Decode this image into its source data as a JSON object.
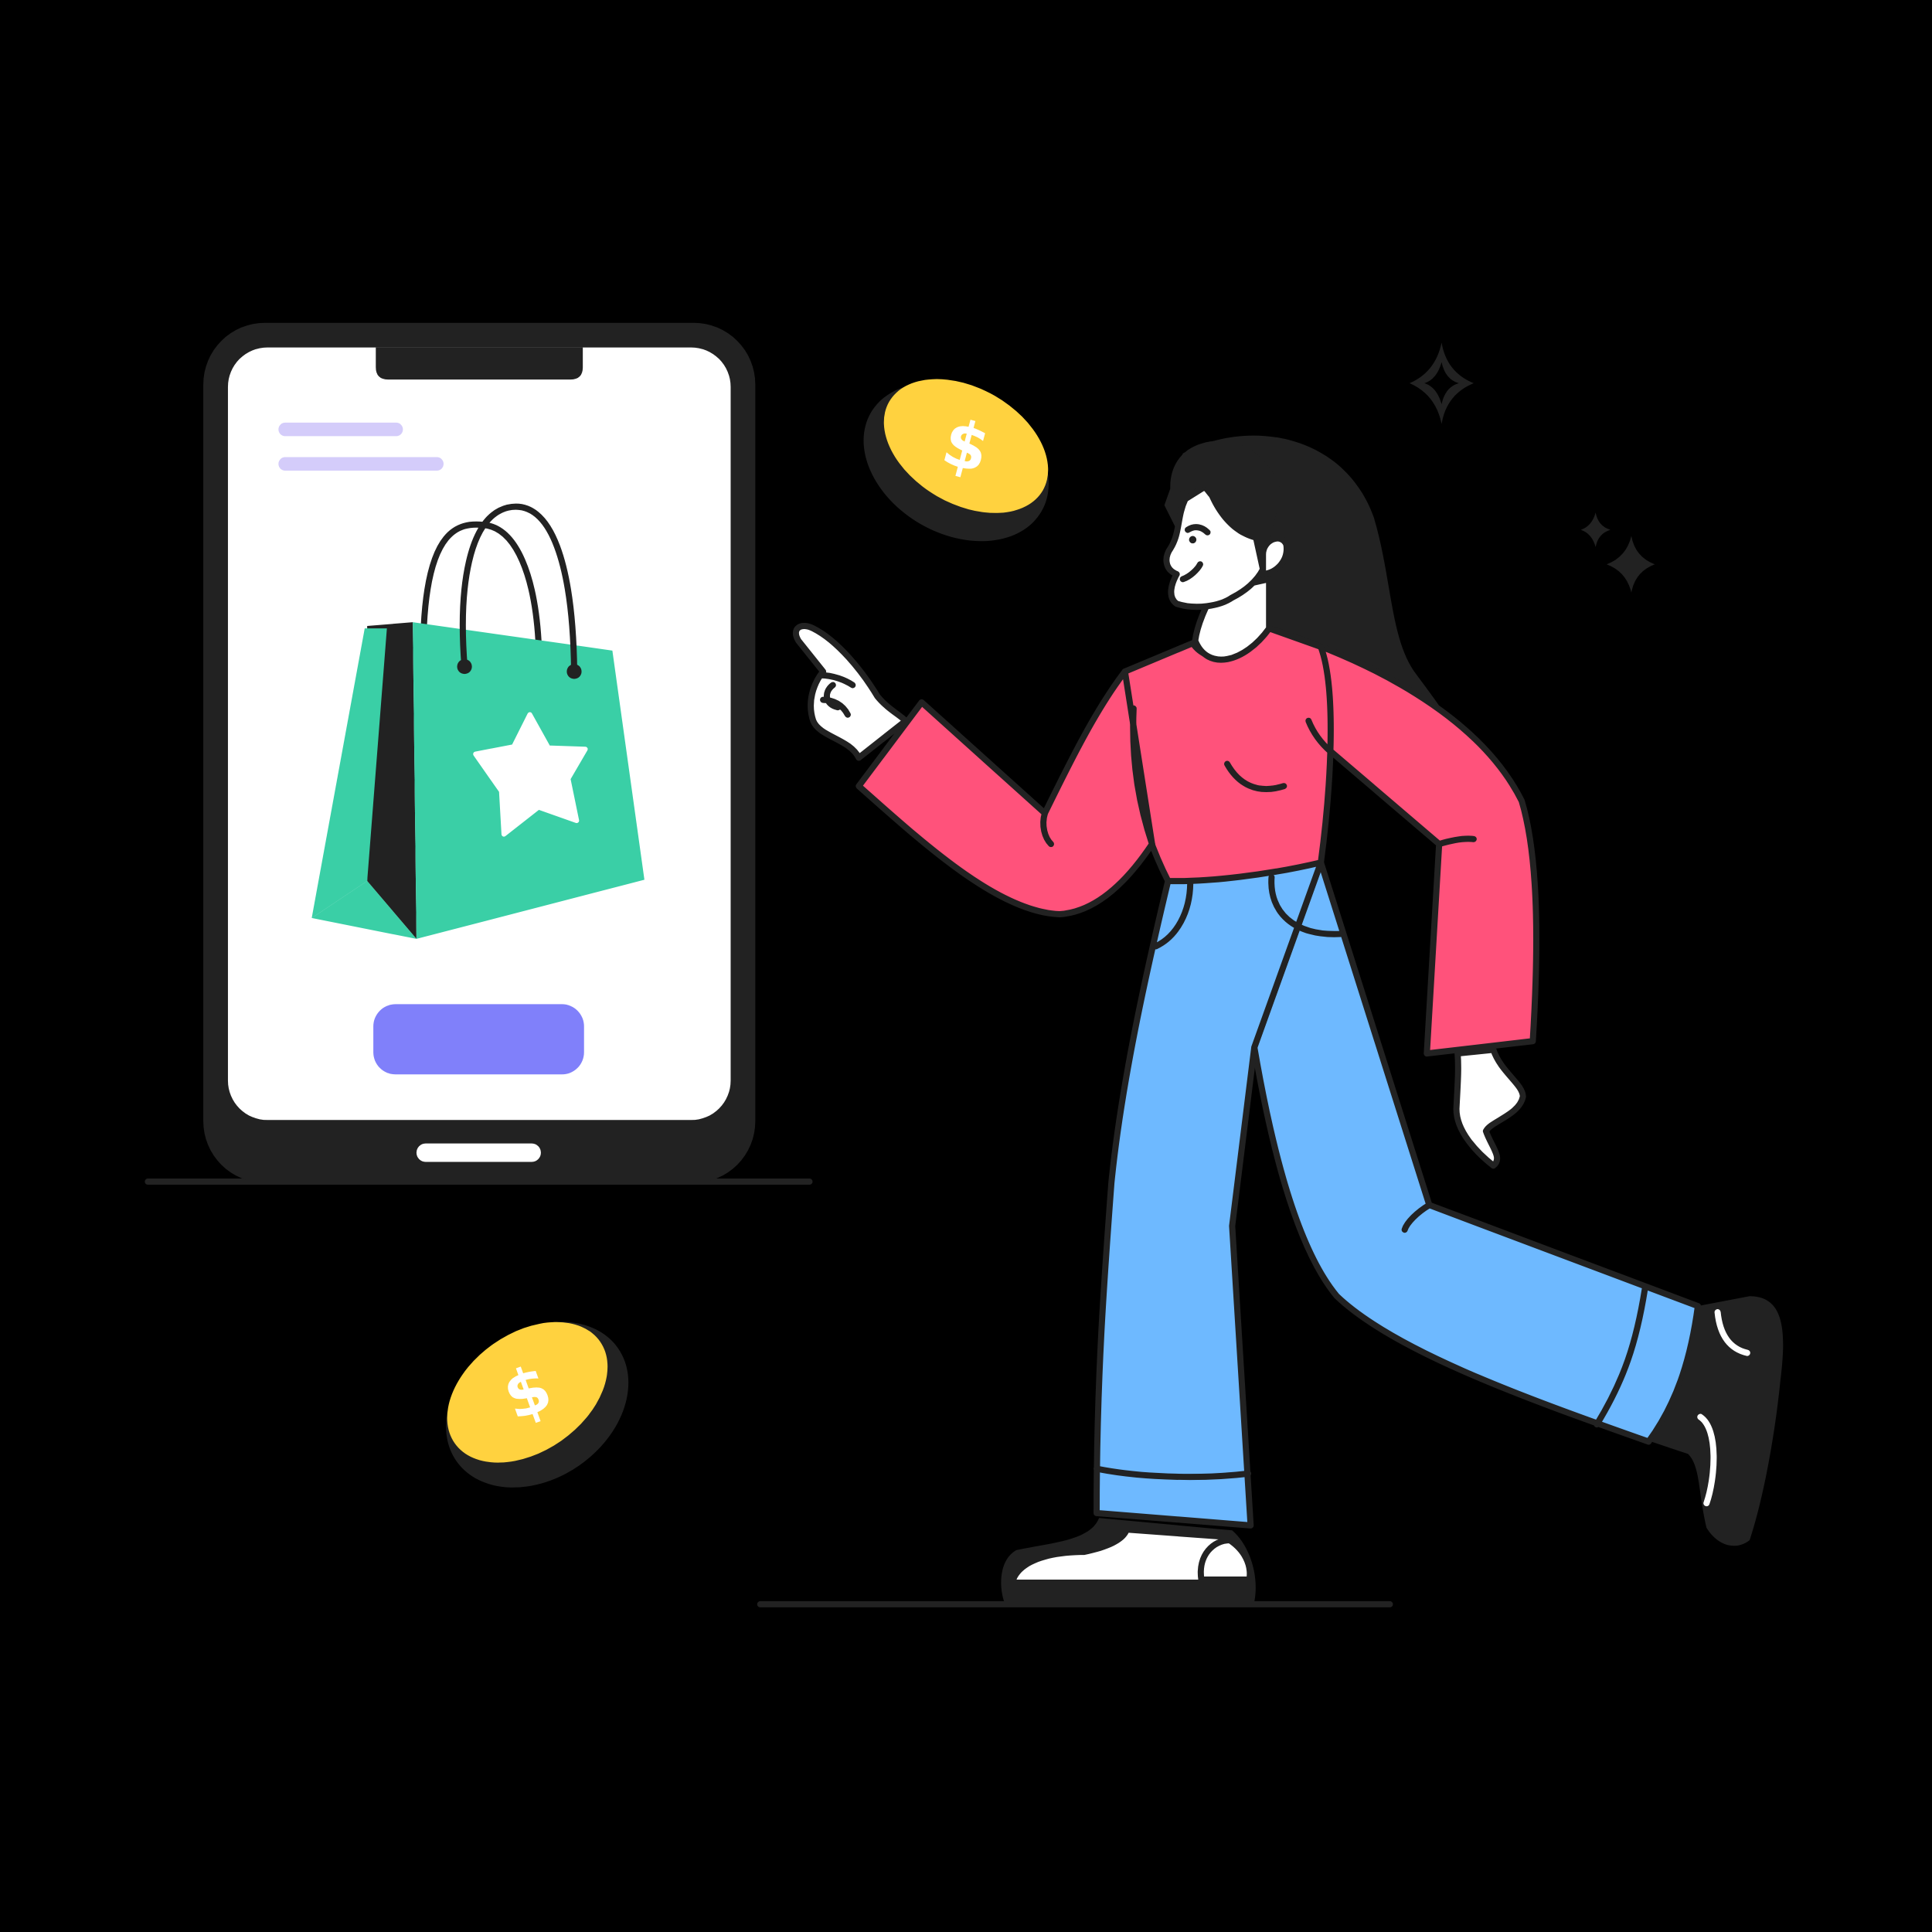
{
  "colors": {
    "background": "#000000",
    "ink": "#222222",
    "screen": "#FFFFFF",
    "text_placeholder": "#D4CCFA",
    "bag_green": "#3ACFA6",
    "star_white": "#FFFFFF",
    "buy_button": "#8080FA",
    "coin_gold": "#FFD23F",
    "coin_rim": "#222222",
    "shirt_pink": "#FF527B",
    "jeans_blue": "#6EB9FF",
    "skin": "#FFFFFF",
    "hair": "#222222",
    "shoe_white": "#FFFFFF"
  },
  "icons": {
    "phone": "smartphone-icon",
    "bag": "shopping-bag-icon",
    "bag_star": "star-icon",
    "coin_glyph": "dollar-sign-icon",
    "sparkle": "sparkle-icon"
  },
  "coin_symbol": "$"
}
